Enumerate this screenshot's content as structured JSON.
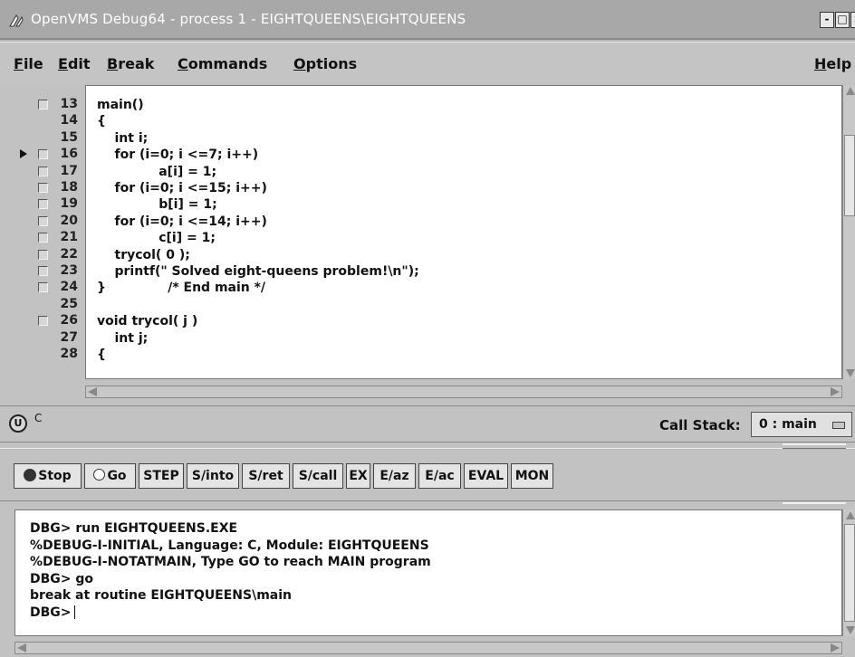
{
  "window": {
    "title": "OpenVMS Debug64 - process 1 - EIGHTQUEENS\\EIGHTQUEENS",
    "minimize_label": "-",
    "maximize_label": "□",
    "close_label": "×"
  },
  "menu": {
    "items": [
      {
        "label": "File",
        "accel": "F"
      },
      {
        "label": "Edit",
        "accel": "E"
      },
      {
        "label": "Break",
        "accel": "B"
      },
      {
        "label": "Commands",
        "accel": "C"
      },
      {
        "label": "Options",
        "accel": "O"
      },
      {
        "label": "Help",
        "accel": "H"
      }
    ]
  },
  "source": {
    "current_line": 16,
    "lines": [
      {
        "num": "13",
        "bp": true,
        "text": "main()"
      },
      {
        "num": "14",
        "bp": false,
        "text": "{"
      },
      {
        "num": "15",
        "bp": false,
        "text": "    int i;"
      },
      {
        "num": "16",
        "bp": true,
        "text": "    for (i=0; i <=7; i++)"
      },
      {
        "num": "17",
        "bp": true,
        "text": "              a[i] = 1;"
      },
      {
        "num": "18",
        "bp": true,
        "text": "    for (i=0; i <=15; i++)"
      },
      {
        "num": "19",
        "bp": true,
        "text": "              b[i] = 1;"
      },
      {
        "num": "20",
        "bp": true,
        "text": "    for (i=0; i <=14; i++)"
      },
      {
        "num": "21",
        "bp": true,
        "text": "              c[i] = 1;"
      },
      {
        "num": "22",
        "bp": true,
        "text": "    trycol( 0 );"
      },
      {
        "num": "23",
        "bp": true,
        "text": "    printf(\" Solved eight-queens problem!\\n\");"
      },
      {
        "num": "24",
        "bp": true,
        "text": "}              /* End main */"
      },
      {
        "num": "25",
        "bp": false,
        "text": ""
      },
      {
        "num": "26",
        "bp": true,
        "text": "void trycol( j )"
      },
      {
        "num": "27",
        "bp": false,
        "text": "    int j;"
      },
      {
        "num": "28",
        "bp": false,
        "text": "{"
      }
    ]
  },
  "status": {
    "u_label": "U",
    "language": "C",
    "call_stack_label": "Call Stack:",
    "call_stack_value": "0 : main"
  },
  "toolbar": {
    "buttons": [
      {
        "label": "Stop",
        "icon": "stop-dot-icon"
      },
      {
        "label": "Go",
        "icon": "go-dot-icon"
      },
      {
        "label": "STEP"
      },
      {
        "label": "S/into"
      },
      {
        "label": "S/ret"
      },
      {
        "label": "S/call"
      },
      {
        "label": "EX"
      },
      {
        "label": "E/az"
      },
      {
        "label": "E/ac"
      },
      {
        "label": "EVAL"
      },
      {
        "label": "MON"
      }
    ]
  },
  "console": {
    "lines": [
      "DBG> run EIGHTQUEENS.EXE",
      "%DEBUG-I-INITIAL, Language: C, Module: EIGHTQUEENS",
      "%DEBUG-I-NOTATMAIN, Type GO to reach MAIN program",
      "DBG> go",
      "break at routine EIGHTQUEENS\\main",
      "DBG>"
    ]
  }
}
